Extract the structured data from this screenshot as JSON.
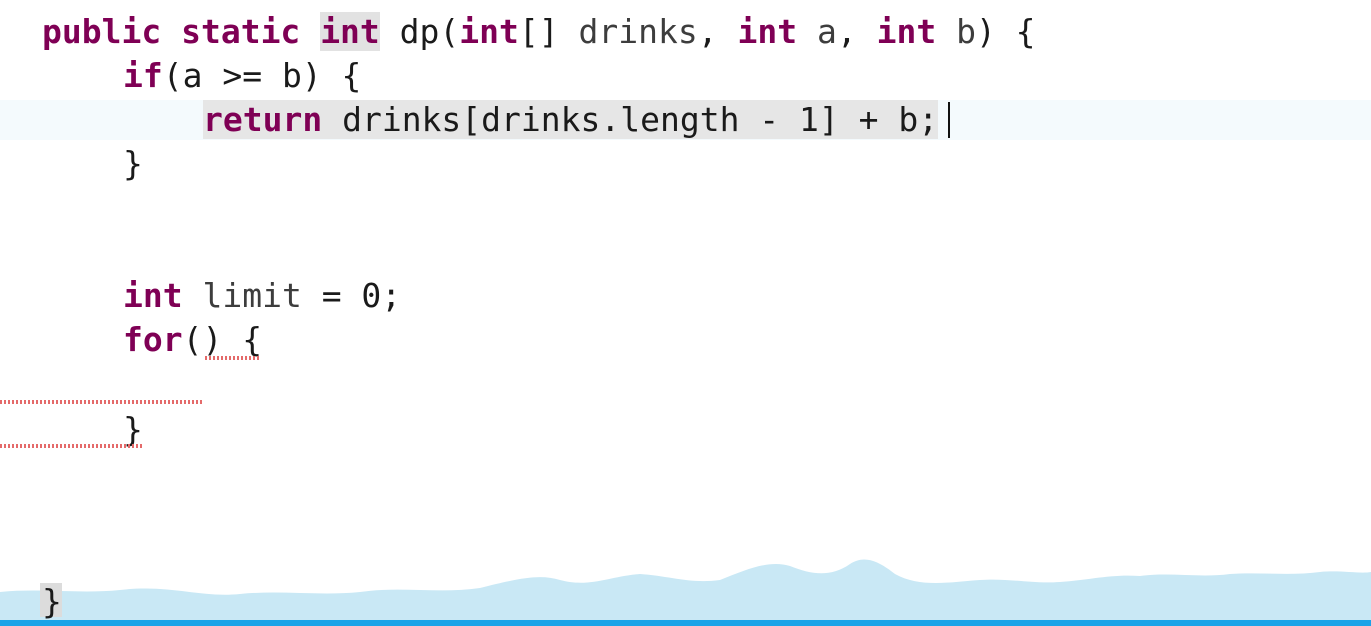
{
  "code": {
    "line1": {
      "public": "public",
      "static": "static",
      "int": "int",
      "dp": "dp(",
      "int2": "int",
      "arr": "[] ",
      "drinks": "drinks",
      "comma1": ", ",
      "int3": "int",
      "a": "a",
      "comma2": ", ",
      "int4": "int",
      "b": "b",
      "close": ") {"
    },
    "line2": {
      "if": "if",
      "rest": "(a >= b) {"
    },
    "line3": {
      "return": "return",
      "rest": " drinks[drinks.length - 1] + b;"
    },
    "line4": {
      "brace": "}"
    },
    "line5": {
      "int": "int",
      "limit": "limit",
      "rest": " = 0;"
    },
    "line6": {
      "for": "for",
      "rest": "() {"
    },
    "line7": {
      "brace": "}"
    },
    "line8": {
      "brace": "}"
    }
  },
  "colors": {
    "keyword": "#7f0055",
    "caret_line_bg": "#f4fafd",
    "error_squiggle": "#e46a6a",
    "wave": "#c9e8f5",
    "accent_bar": "#1aa3e8"
  }
}
